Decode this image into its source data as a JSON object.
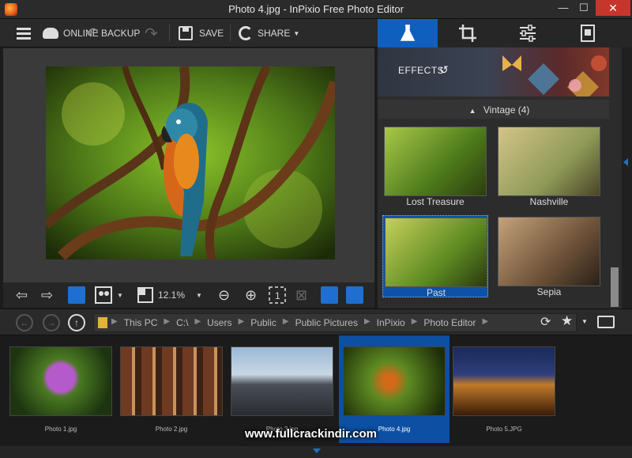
{
  "window": {
    "title": "Photo 4.jpg - InPixio Free Photo Editor",
    "close": "✕",
    "maximize": "☐",
    "minimize": "—"
  },
  "toolbar": {
    "online_backup": "ONLINE BACKUP",
    "save": "SAVE",
    "share": "SHARE"
  },
  "right_tabs": [
    "effects-tab",
    "crop-tab",
    "adjust-tab",
    "frames-tab"
  ],
  "effects": {
    "banner_label": "EFFECTS",
    "group_header": "Vintage (4)"
  },
  "effect_thumbs": [
    {
      "label": "Lost Treasure"
    },
    {
      "label": "Nashville"
    },
    {
      "label": "Past"
    },
    {
      "label": "Sepia"
    }
  ],
  "photo_tools": {
    "zoom": "12.1%"
  },
  "address": {
    "crumbs": [
      "This PC",
      "C:\\",
      "Users",
      "Public",
      "Public Pictures",
      "InPixio",
      "Photo Editor"
    ]
  },
  "filmstrip": [
    {
      "caption": "Photo 1.jpg"
    },
    {
      "caption": "Photo 2.jpg"
    },
    {
      "caption": "Photo 3.jpg"
    },
    {
      "caption": "Photo 4.jpg"
    },
    {
      "caption": "Photo 5.JPG"
    }
  ],
  "watermark": "www.fullcrackindir.com",
  "colors": {
    "accent": "#0f5fbf",
    "close": "#c7362c",
    "background": "#1c1c1c"
  }
}
